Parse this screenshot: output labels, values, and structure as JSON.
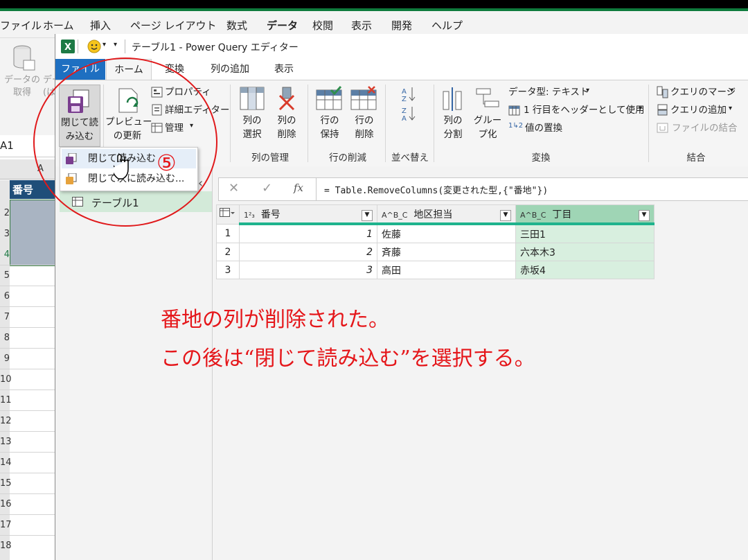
{
  "excel": {
    "menu": [
      "ファイル",
      "ホーム",
      "挿入",
      "ページ レイアウト",
      "数式",
      "データ",
      "校閲",
      "表示",
      "開発",
      "ヘルプ"
    ],
    "get_data": "データの\n取得",
    "get_data_2": "デー\n(は",
    "namebox": "A1",
    "col_a": "A",
    "header_cell": "番号",
    "rows": [
      "2",
      "3",
      "4",
      "5",
      "6",
      "7",
      "8",
      "9",
      "10",
      "11",
      "12",
      "13",
      "14",
      "15",
      "16",
      "17",
      "18"
    ]
  },
  "pq": {
    "title": "テーブル1 - Power Query エディター",
    "tabs": [
      "ファイル",
      "ホーム",
      "変換",
      "列の追加",
      "表示"
    ],
    "ribbon": {
      "close_load": "閉じて読\nみ込む",
      "preview": "プレビュー\nの更新",
      "properties": "プロパティ",
      "advanced": "詳細エディター",
      "manage": "管理",
      "select_cols": "列の\n選択",
      "delete_cols": "列の\n削除",
      "keep_rows": "行の\n保持",
      "remove_rows": "行の\n削除",
      "split_col": "列の\n分割",
      "group_by": "グルー\nプ化",
      "datatype": "データ型: テキスト",
      "first_row_header": "1 行目をヘッダーとして使用",
      "replace_values": "値の置換",
      "merge_queries": "クエリのマージ",
      "append_queries": "クエリの追加",
      "combine_files": "ファイルの結合",
      "groups": [
        "列の管理",
        "行の削減",
        "並べ替え",
        "変換",
        "結合"
      ]
    },
    "dropdown": [
      "閉じて読み込む",
      "閉じて次に読み込む..."
    ],
    "query_item": "テーブル1",
    "formula": "= Table.RemoveColumns(変更された型,{\"番地\"})",
    "formula_fx": "fx",
    "columns": [
      {
        "type": "1²₃",
        "name": "番号"
      },
      {
        "type": "A^B_C",
        "name": "地区担当"
      },
      {
        "type": "A^B_C",
        "name": "丁目"
      }
    ],
    "rows": [
      {
        "n": "1",
        "num": "1",
        "area": "佐藤",
        "chome": "三田1"
      },
      {
        "n": "2",
        "num": "2",
        "area": "斉藤",
        "chome": "六本木3"
      },
      {
        "n": "3",
        "num": "3",
        "area": "高田",
        "chome": "赤坂4"
      }
    ]
  },
  "annotation": {
    "step": "⑤",
    "line1": "番地の列が削除された。",
    "line2": "この後は“閉じて読み込む”を選択する。",
    "color": "#e5161a"
  }
}
